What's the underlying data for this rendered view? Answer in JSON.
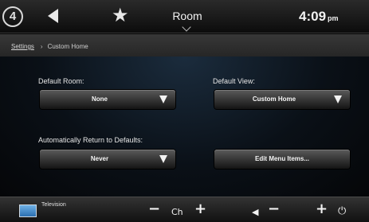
{
  "header": {
    "logo": "4",
    "title": "Room",
    "time": "4:09",
    "ampm": "pm"
  },
  "breadcrumb": {
    "root": "Settings",
    "separator": "›",
    "current": "Custom Home"
  },
  "settings": {
    "default_room_label": "Default Room:",
    "default_room_value": "None",
    "default_view_label": "Default View:",
    "default_view_value": "Custom Home",
    "auto_return_label": "Automatically Return to Defaults:",
    "auto_return_value": "Never",
    "edit_menu_label": "Edit Menu Items..."
  },
  "bottom": {
    "source_label": "Television",
    "minus_sign": "−",
    "ch_label": "Ch",
    "plus_sign": "+",
    "mute_glyph": "◀",
    "power_glyph": "⏻"
  },
  "icons": {
    "logo": "logo-icon",
    "back": "back-arrow-icon",
    "favorite": "star-icon",
    "room_menu": "chevron-down-icon",
    "dropdown": "triangle-down-icon",
    "source": "television-icon",
    "volume": "speaker-icon",
    "power": "power-icon"
  }
}
